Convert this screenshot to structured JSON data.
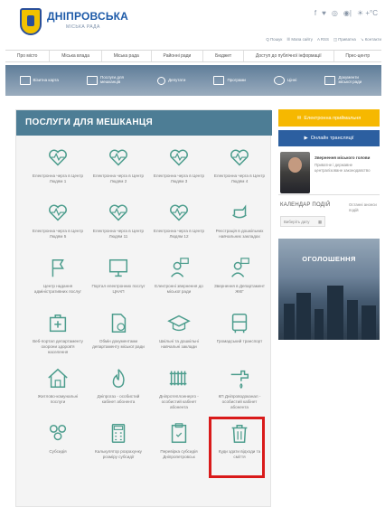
{
  "header": {
    "logo_title": "ДНІПРОВСЬКА",
    "logo_subtitle": "МІСЬКА РАДА",
    "social": [
      "f",
      "♥",
      "◎",
      "◉|",
      "☀ +°C"
    ],
    "top_links": [
      "Q Пошук",
      "☰ Мапа сайту",
      "A RSS",
      "◫ Приватна",
      "↘ Контакти"
    ]
  },
  "nav": {
    "items": [
      "Про місто",
      "Міська влада",
      "Міська рада",
      "Районні ради",
      "Бюджет",
      "Доступ до публічної інформації",
      "Прес-центр"
    ]
  },
  "banner": {
    "links": [
      {
        "label": "Візитна карта",
        "icon": "id-card-icon"
      },
      {
        "label": "Послуги для мешканців",
        "icon": "grid-icon"
      },
      {
        "label": "Депутати",
        "icon": "person-icon"
      },
      {
        "label": "Програми",
        "icon": "document-icon"
      },
      {
        "label": "Цінні",
        "icon": "badge-icon"
      },
      {
        "label": "Документи міської ради",
        "icon": "folder-icon"
      }
    ]
  },
  "services": {
    "title": "ПОСЛУГИ ДЛЯ МЕШКАНЦЯ",
    "items": [
      {
        "label": "Електронна черга в Центр Людям 1",
        "icon": "heart-pulse-icon"
      },
      {
        "label": "Електронна черга в Центр Людям 2",
        "icon": "heart-pulse-icon"
      },
      {
        "label": "Електронна черга в Центр Людям 3",
        "icon": "heart-pulse-icon"
      },
      {
        "label": "Електронна черга в Центр Людям 4",
        "icon": "heart-pulse-icon"
      },
      {
        "label": "Електронна черга в Центр Людям 5",
        "icon": "heart-pulse-icon"
      },
      {
        "label": "Електронна черга в Центр Людям 11",
        "icon": "heart-pulse-icon"
      },
      {
        "label": "Електронна черга в Центр Людям 12",
        "icon": "heart-pulse-icon"
      },
      {
        "label": "Реєстрація в дошкільних навчальних закладах",
        "icon": "rocking-horse-icon"
      },
      {
        "label": "Центр надання адміністративних послуг",
        "icon": "flag-icon"
      },
      {
        "label": "Портал електронних послуг ЦНАП",
        "icon": "monitor-icon"
      },
      {
        "label": "Електронні звернення до міської ради",
        "icon": "person-chat-icon"
      },
      {
        "label": "Звернення в Департамент ЖКГ",
        "icon": "person-chat-icon"
      },
      {
        "label": "Веб-портал департаменту охорони здоров'я населення",
        "icon": "medical-kit-icon"
      },
      {
        "label": "Обмін документами департаменту міської ради",
        "icon": "document-check-icon"
      },
      {
        "label": "Шкільні та дошкільні навчальні заклади",
        "icon": "graduation-cap-icon"
      },
      {
        "label": "Громадський транспорт",
        "icon": "bus-icon"
      },
      {
        "label": "Житлово-комунальні послуги",
        "icon": "house-icon"
      },
      {
        "label": "Дніпрогаз - особистий кабінет абонента",
        "icon": "gas-flame-icon"
      },
      {
        "label": "Дніпротеплоенерго - особистий кабінет абонента",
        "icon": "radiator-icon"
      },
      {
        "label": "КП Дніпроводоканал - особистий кабінет абонента",
        "icon": "water-tap-icon"
      },
      {
        "label": "Субсидія",
        "icon": "people-icon"
      },
      {
        "label": "Калькулятор розрахунку розміру субсидії",
        "icon": "calculator-icon"
      },
      {
        "label": "Перевірка субсидія Дніпропетровськ",
        "icon": "clipboard-icon"
      },
      {
        "label": "Куди здати відходи та сміття",
        "icon": "trash-can-icon"
      }
    ]
  },
  "sidebar": {
    "ebudget_label": "Електронна приймальня",
    "broadcast_label": "Онлайн трансляції",
    "mayor_title": "Звернення міського голови",
    "mayor_text": "Приватне і державне централізоване законодавство",
    "calendar_title": "КАЛЕНДАР ПОДІЙ",
    "calendar_select": "Виберіть дату",
    "calendar_note": "Останні анонси подій",
    "announce_title": "ОГОЛОШЕННЯ"
  },
  "colors": {
    "panel_header": "#4d7d95",
    "icon_teal": "#4c9d8d",
    "highlight": "#d91a1a",
    "yellow_button": "#f6b800",
    "blue_button": "#2c5fa0"
  }
}
